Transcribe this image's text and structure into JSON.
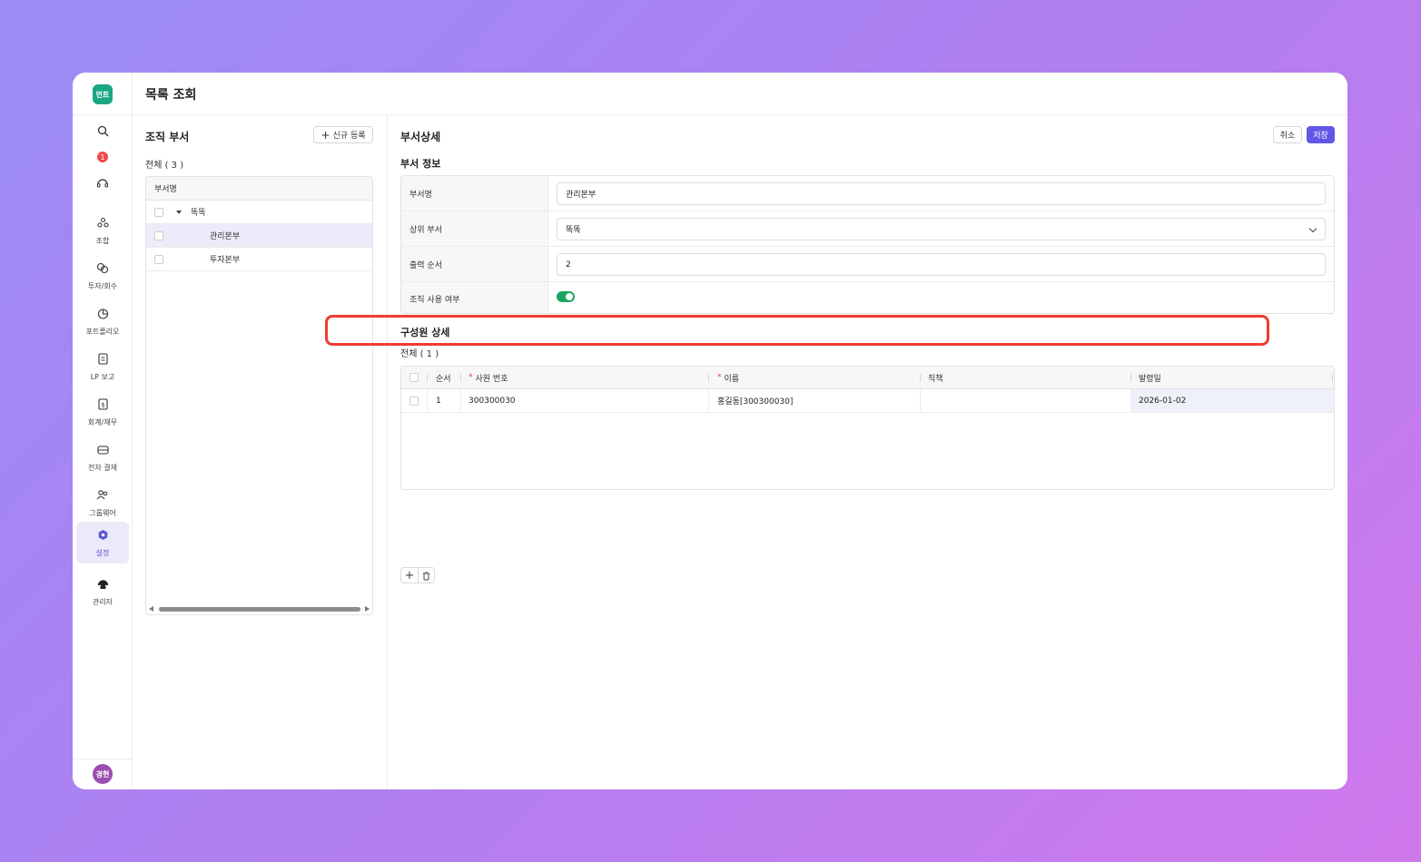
{
  "app": {
    "logo_text": "먼트",
    "page_title": "목록 조회",
    "notification_count": "1",
    "user_initials": "경현"
  },
  "sidebar": {
    "items": [
      {
        "label": "조합",
        "icon": "union-icon"
      },
      {
        "label": "투자/회수",
        "icon": "investment-icon"
      },
      {
        "label": "포트폴리오",
        "icon": "portfolio-icon"
      },
      {
        "label": "LP 보고",
        "icon": "report-icon"
      },
      {
        "label": "회계/재무",
        "icon": "accounting-icon"
      },
      {
        "label": "전자 결재",
        "icon": "approval-icon"
      },
      {
        "label": "그룹웨어",
        "icon": "groupware-icon"
      },
      {
        "label": "설정",
        "icon": "settings-icon"
      },
      {
        "label": "관리자",
        "icon": "admin-icon"
      }
    ],
    "active_item": "설정"
  },
  "org_panel": {
    "title": "조직 부서",
    "new_button_label": "신규 등록",
    "count_label": "전체 ( 3 )",
    "column_header": "부서명",
    "tree": [
      {
        "name": "똑똑",
        "level": 0,
        "expanded": true
      },
      {
        "name": "관리본부",
        "level": 1,
        "selected": true
      },
      {
        "name": "투자본부",
        "level": 1
      }
    ]
  },
  "detail_panel": {
    "title": "부서상세",
    "cancel_label": "취소",
    "save_label": "저장",
    "section_title": "부서 정보",
    "fields": {
      "dept_name_label": "부서명",
      "dept_name_value": "관리본부",
      "parent_label": "상위 부서",
      "parent_value": "똑똑",
      "order_label": "출력 순서",
      "order_value": "2",
      "active_label": "조직 사용 여부",
      "active_value": true
    },
    "members": {
      "title": "구성원 상세",
      "count_label": "전체 ( 1 )",
      "columns": [
        "순서",
        "사원 번호",
        "이름",
        "직책",
        "발령일"
      ],
      "required_columns": [
        "사원 번호",
        "이름"
      ],
      "rows": [
        {
          "order": "1",
          "emp_no": "300300030",
          "name": "홍길동[300300030]",
          "position": "",
          "date": "2026-01-02"
        }
      ]
    }
  },
  "colors": {
    "accent": "#6157e6",
    "logo": "#1aa683",
    "toggle_on": "#1aa65f",
    "highlight": "#f03c32",
    "notification": "#f04a4a"
  }
}
